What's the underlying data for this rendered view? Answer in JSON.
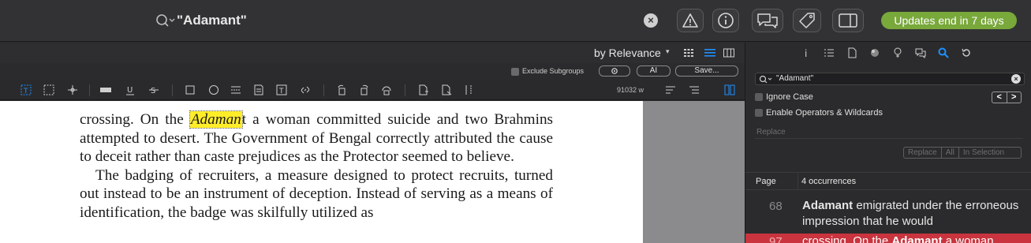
{
  "search": {
    "query": "\"Adamant\"",
    "clear_symbol": "×"
  },
  "updates": {
    "label": "Updates end in 7 days"
  },
  "sort": {
    "label": "by Relevance",
    "caret": "▾"
  },
  "options": {
    "exclude_subgroups": "Exclude Subgroups",
    "ai_label": "AI",
    "save_label": "Save..."
  },
  "toolbar": {
    "word_count": "91032 w"
  },
  "document": {
    "para1_before": "crossing. On the ",
    "para1_highlight": "Adaman",
    "para1_after": "t a woman committed suicide and two Brahmins attempted to desert. The Government of Bengal correctly attributed the cause to deceit rather than caste prejudices as the Protector seemed to believe.",
    "para2": "The badging of recruiters, a measure designed to protect recruits, turned out instead to be an instrument of deception. Instead of serving as a means of identification, the badge was skilfully utilized as"
  },
  "inspector": {
    "search_value": "\"Adamant\"",
    "ignore_case": "Ignore Case",
    "enable_operators": "Enable Operators & Wildcards",
    "prev": "<",
    "next": ">",
    "replace_placeholder": "Replace",
    "replace_btn": "Replace",
    "all_btn": "All",
    "in_selection_btn": "In Selection",
    "results_col_page": "Page",
    "results_count": "4 occurrences",
    "results": [
      {
        "page": "68",
        "bold": "Adamant",
        "text": " emigrated under the erroneous impression that he would"
      },
      {
        "page": "97",
        "pre": "crossing. On the ",
        "bold": "Adamant",
        "text": " a woman"
      }
    ]
  },
  "colors": {
    "accent_green": "#79a83b",
    "highlight_yellow": "#ffed29",
    "selected_red": "#c9343e",
    "accent_blue": "#1e90ff"
  }
}
